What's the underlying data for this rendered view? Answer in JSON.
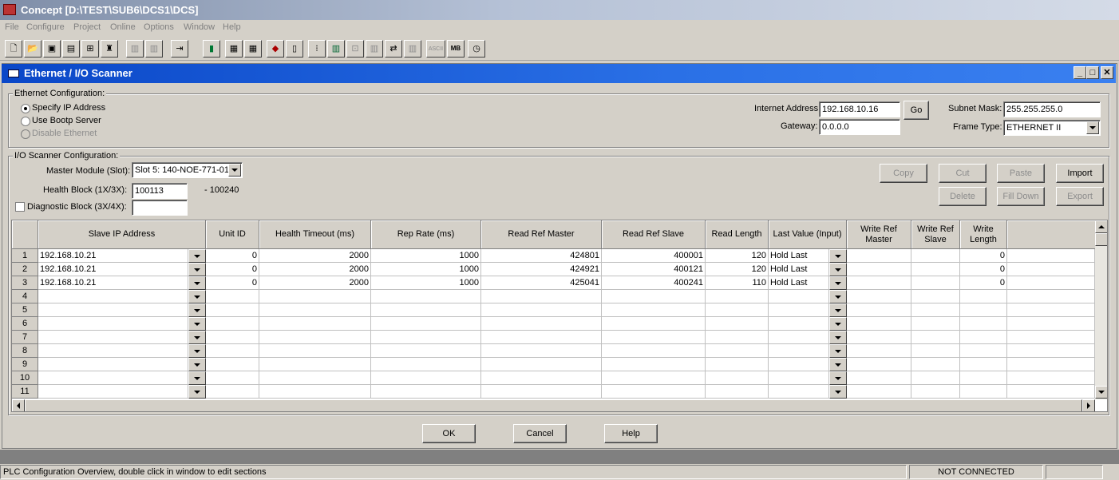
{
  "app": {
    "title": "Concept [D:\\TEST\\SUB6\\DCS1\\DCS]"
  },
  "menu": [
    "File",
    "Configure",
    "Project",
    "Online",
    "Options",
    "Window",
    "Help"
  ],
  "toolbar": {
    "icons": [
      "new-file-icon",
      "open-folder-icon",
      "save-icon",
      "print-icon",
      "tree-icon",
      "find-icon",
      "plc-disabled-icon",
      "plc2-disabled-icon",
      "io-map-icon",
      "module-icon",
      "segment-icon",
      "keyboard-icon",
      "truck-icon",
      "rack-icon",
      "numbers-icon",
      "registers-icon",
      "lock-icon",
      "bars-icon",
      "transfer-icon",
      "chart-icon",
      "ascii-icon",
      "mb-icon",
      "clock-icon"
    ],
    "ascii_label": "ASCII",
    "mb_label": "MB"
  },
  "dialog": {
    "title": "Ethernet / I/O Scanner",
    "ethernet_config": {
      "label": "Ethernet Configuration:",
      "options": [
        "Specify IP Address",
        "Use Bootp Server",
        "Disable Ethernet"
      ],
      "selected": "Specify IP Address",
      "internet_address_label": "Internet Address:",
      "internet_address": "192.168.10.16",
      "go_label": "Go",
      "subnet_mask_label": "Subnet Mask:",
      "subnet_mask": "255.255.255.0",
      "gateway_label": "Gateway:",
      "gateway": "0.0.0.0",
      "frame_type_label": "Frame Type:",
      "frame_type": "ETHERNET II"
    },
    "io_scanner": {
      "label": "I/O Scanner Configuration:",
      "master_module_label": "Master Module (Slot):",
      "master_module": "Slot 5: 140-NOE-771-01",
      "health_block_label": "Health Block (1X/3X):",
      "health_block": "100113",
      "health_block_end": "- 100240",
      "diagnostic_block_label": "Diagnostic Block (3X/4X):",
      "diagnostic_block": "",
      "buttons": {
        "copy": "Copy",
        "cut": "Cut",
        "paste": "Paste",
        "import": "Import",
        "delete": "Delete",
        "fill_down": "Fill Down",
        "export": "Export"
      }
    },
    "grid": {
      "headers": [
        "Slave IP Address",
        "Unit ID",
        "Health Timeout (ms)",
        "Rep Rate (ms)",
        "Read Ref Master",
        "Read Ref Slave",
        "Read Length",
        "Last Value (Input)",
        "Write Ref Master",
        "Write Ref Slave",
        "Write Length"
      ],
      "rows": [
        {
          "n": "1",
          "ip": "192.168.10.21",
          "unit": "0",
          "timeout": "2000",
          "rate": "1000",
          "rrm": "424801",
          "rrs": "400001",
          "rlen": "120",
          "last": "Hold Last",
          "wrm": "",
          "wrs": "",
          "wlen": "0"
        },
        {
          "n": "2",
          "ip": "192.168.10.21",
          "unit": "0",
          "timeout": "2000",
          "rate": "1000",
          "rrm": "424921",
          "rrs": "400121",
          "rlen": "120",
          "last": "Hold Last",
          "wrm": "",
          "wrs": "",
          "wlen": "0"
        },
        {
          "n": "3",
          "ip": "192.168.10.21",
          "unit": "0",
          "timeout": "2000",
          "rate": "1000",
          "rrm": "425041",
          "rrs": "400241",
          "rlen": "110",
          "last": "Hold Last",
          "wrm": "",
          "wrs": "",
          "wlen": "0"
        },
        {
          "n": "4",
          "ip": "",
          "unit": "",
          "timeout": "",
          "rate": "",
          "rrm": "",
          "rrs": "",
          "rlen": "",
          "last": "",
          "wrm": "",
          "wrs": "",
          "wlen": ""
        },
        {
          "n": "5",
          "ip": "",
          "unit": "",
          "timeout": "",
          "rate": "",
          "rrm": "",
          "rrs": "",
          "rlen": "",
          "last": "",
          "wrm": "",
          "wrs": "",
          "wlen": ""
        },
        {
          "n": "6",
          "ip": "",
          "unit": "",
          "timeout": "",
          "rate": "",
          "rrm": "",
          "rrs": "",
          "rlen": "",
          "last": "",
          "wrm": "",
          "wrs": "",
          "wlen": ""
        },
        {
          "n": "7",
          "ip": "",
          "unit": "",
          "timeout": "",
          "rate": "",
          "rrm": "",
          "rrs": "",
          "rlen": "",
          "last": "",
          "wrm": "",
          "wrs": "",
          "wlen": ""
        },
        {
          "n": "8",
          "ip": "",
          "unit": "",
          "timeout": "",
          "rate": "",
          "rrm": "",
          "rrs": "",
          "rlen": "",
          "last": "",
          "wrm": "",
          "wrs": "",
          "wlen": ""
        },
        {
          "n": "9",
          "ip": "",
          "unit": "",
          "timeout": "",
          "rate": "",
          "rrm": "",
          "rrs": "",
          "rlen": "",
          "last": "",
          "wrm": "",
          "wrs": "",
          "wlen": ""
        },
        {
          "n": "10",
          "ip": "",
          "unit": "",
          "timeout": "",
          "rate": "",
          "rrm": "",
          "rrs": "",
          "rlen": "",
          "last": "",
          "wrm": "",
          "wrs": "",
          "wlen": ""
        },
        {
          "n": "11",
          "ip": "",
          "unit": "",
          "timeout": "",
          "rate": "",
          "rrm": "",
          "rrs": "",
          "rlen": "",
          "last": "",
          "wrm": "",
          "wrs": "",
          "wlen": ""
        }
      ]
    },
    "footer": {
      "ok": "OK",
      "cancel": "Cancel",
      "help": "Help"
    }
  },
  "status": {
    "message": "PLC Configuration Overview, double click in window to edit sections",
    "connection": "NOT CONNECTED"
  },
  "colors": {
    "title_active": "#0a47c8",
    "app_title": "#7f8ea8",
    "face": "#d4d0c8"
  }
}
